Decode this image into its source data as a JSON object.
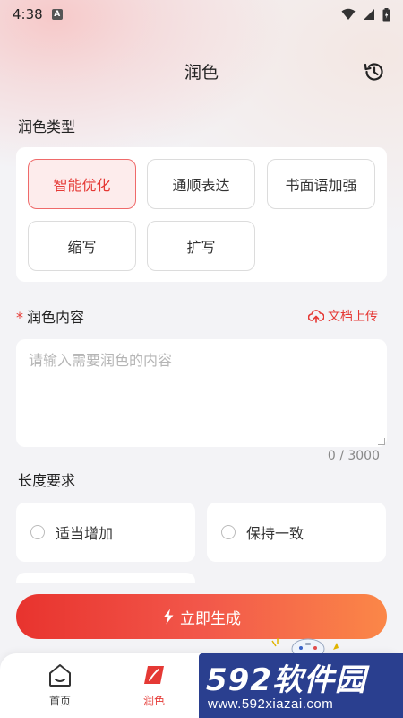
{
  "status_bar": {
    "time": "4:38",
    "notif_badge": "A"
  },
  "header": {
    "title": "润色"
  },
  "polish_type": {
    "label": "润色类型",
    "options": [
      "智能优化",
      "通顺表达",
      "书面语加强",
      "缩写",
      "扩写"
    ],
    "selected_index": 0
  },
  "content": {
    "required_mark": "*",
    "label": "润色内容",
    "upload_label": "文档上传",
    "placeholder": "请输入需要润色的内容",
    "value": "",
    "char_count": "0 / 3000"
  },
  "length": {
    "label": "长度要求",
    "options": [
      "适当增加",
      "保持一致"
    ]
  },
  "generate_button": {
    "label": "立即生成"
  },
  "tabs": [
    {
      "label": "首页",
      "active": false
    },
    {
      "label": "润色",
      "active": true
    }
  ],
  "watermark": {
    "brand": "592软件园",
    "url": "www.592xiazai.com"
  },
  "colors": {
    "accent": "#e53935",
    "button_start": "#e8332e",
    "button_end": "#fb8748"
  }
}
